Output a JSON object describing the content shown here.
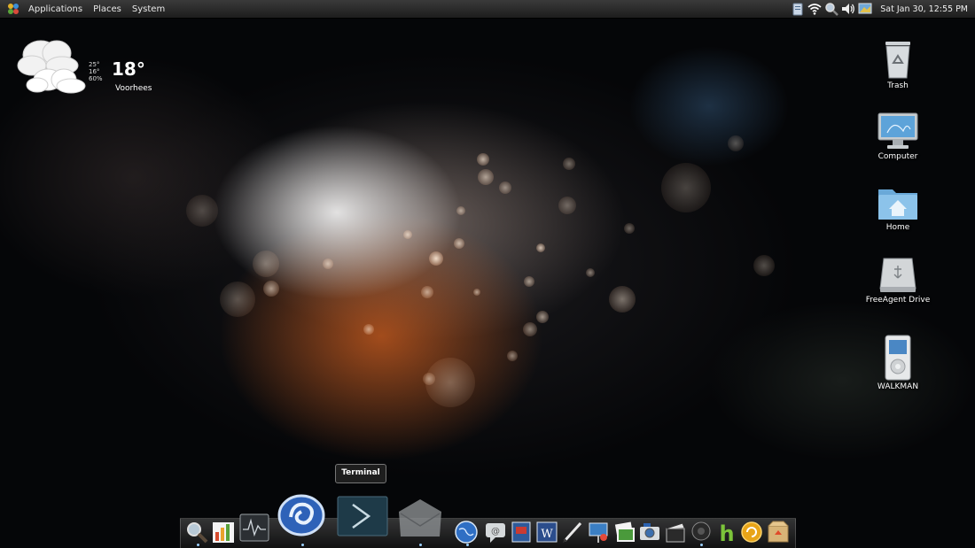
{
  "panel": {
    "menus": [
      "Applications",
      "Places",
      "System"
    ],
    "clock": "Sat Jan 30, 12:55 PM",
    "tray_icons": [
      "clipboard-icon",
      "wifi-icon",
      "search-icon",
      "volume-icon",
      "display-icon"
    ]
  },
  "weather": {
    "high": "25°",
    "low": "16°",
    "humidity": "60%",
    "temp": "18°",
    "location": "Voorhees"
  },
  "desktop_icons": [
    {
      "label": "Trash",
      "icon": "trash-icon"
    },
    {
      "label": "Computer",
      "icon": "computer-icon"
    },
    {
      "label": "Home",
      "icon": "home-folder-icon"
    },
    {
      "label": "FreeAgent Drive",
      "icon": "external-drive-icon"
    },
    {
      "label": "WALKMAN",
      "icon": "media-player-icon"
    }
  ],
  "tooltip": "Terminal",
  "dock_items": [
    "search-icon",
    "chart-app-icon",
    "system-monitor-icon",
    "browser-swirl-icon",
    "terminal-icon",
    "mail-icon",
    "globe-browser-icon",
    "chat-icon",
    "book-icon",
    "dictionary-icon",
    "pen-icon",
    "presentation-icon",
    "photos-icon",
    "camera-icon",
    "film-icon",
    "webcam-icon",
    "h-app-icon",
    "updater-icon",
    "package-icon"
  ]
}
